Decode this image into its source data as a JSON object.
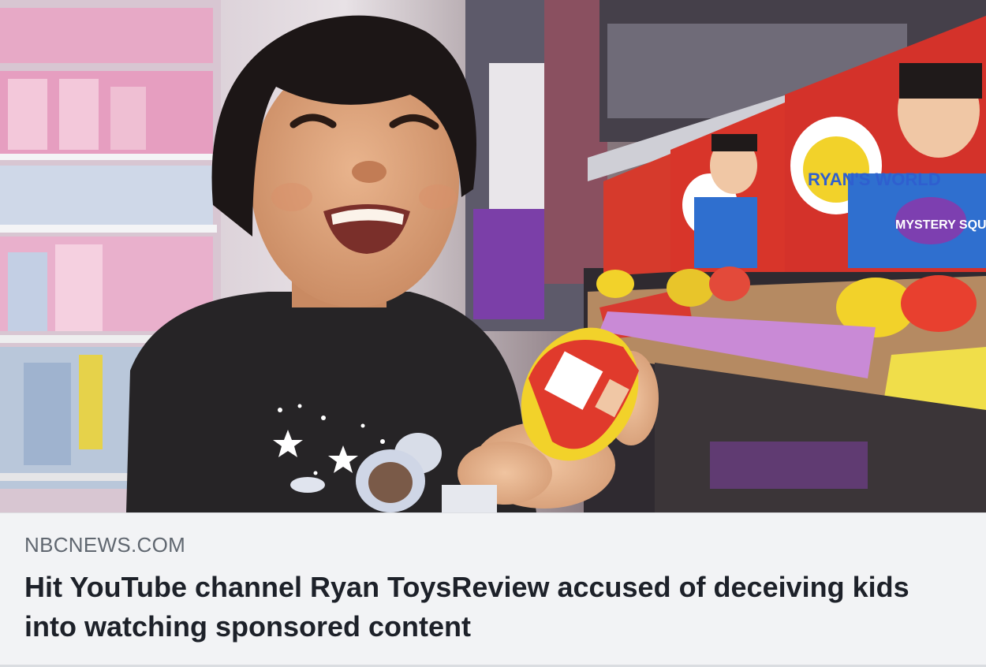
{
  "link_preview": {
    "domain": "NBCNEWS.COM",
    "headline": "Hit YouTube channel Ryan ToysReview accused of deceiving kids into watching sponsored content",
    "image": {
      "alt": "Smiling child holding a toy egg in a store toy aisle",
      "box_text": [
        "RYAN'S WORLD",
        "MYSTERY SQUISHY"
      ]
    }
  },
  "colors": {
    "caption_background": "#f2f3f5",
    "domain_text": "#606770",
    "headline_text": "#1d2129"
  }
}
